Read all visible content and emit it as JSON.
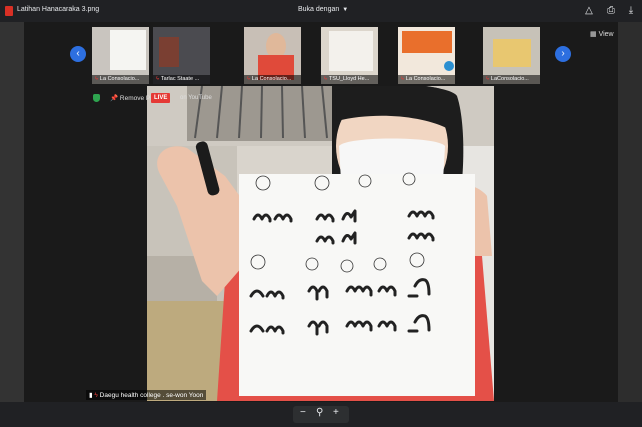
{
  "topbar": {
    "file_title": "Latihan Hanacaraka 3.png",
    "open_with": "Buka dengan",
    "icons": [
      "add-to-drive-icon",
      "print-icon",
      "download-icon"
    ]
  },
  "meeting": {
    "thumbnails": [
      {
        "name": "La Consolacio..."
      },
      {
        "name": "Tarlac Staate ..."
      },
      {
        "name": "La Consolacio..."
      },
      {
        "name": "TSU_Lloyd He..."
      },
      {
        "name": "La Consolacio..."
      },
      {
        "name": "LaConsolacio..."
      }
    ],
    "view_label": "View",
    "remove_pin_label": "Remove Pin",
    "live_badge": "LIVE",
    "live_platform": "on YouTube",
    "speaker_label": "Daegu health college . se-won Yoon"
  },
  "zoom_controls": {
    "minus": "−",
    "plus": "+"
  }
}
